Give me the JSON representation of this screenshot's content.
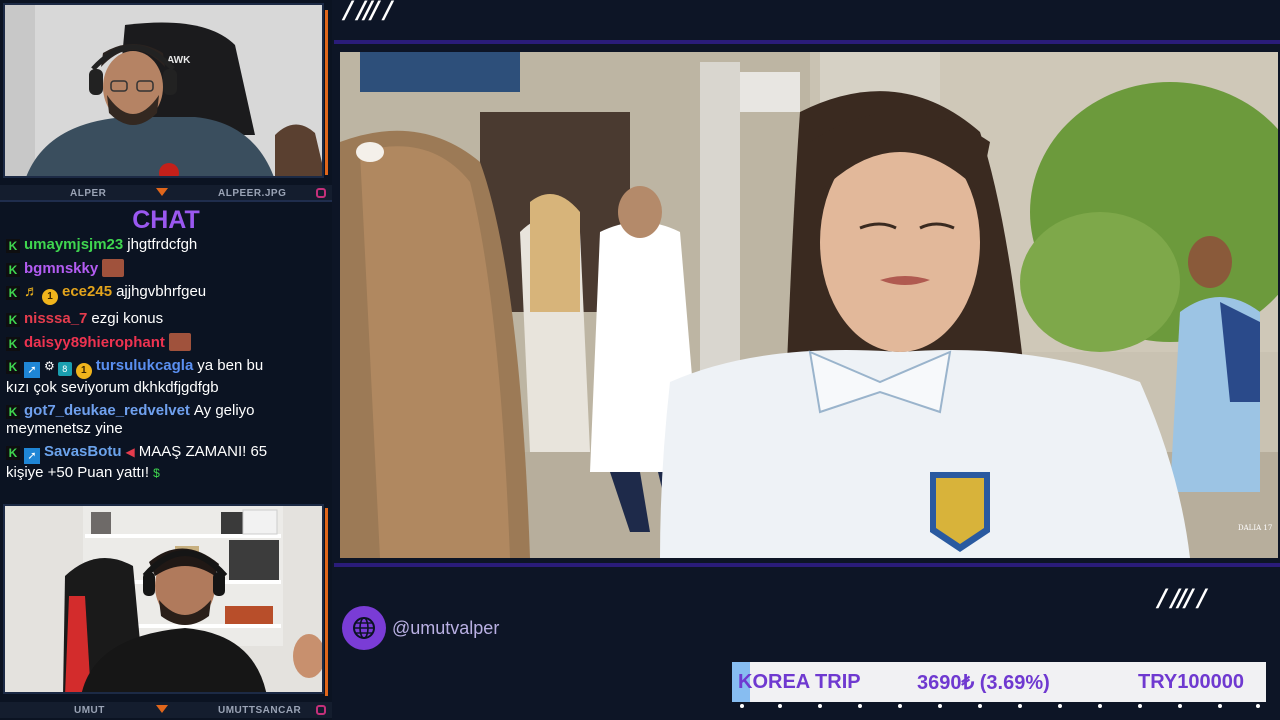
{
  "top_cam": {
    "name_left": "ALPER",
    "name_right": "ALPEER.JPG"
  },
  "bottom_cam": {
    "name_left": "UMUT",
    "name_right": "UMUTTSANCAR"
  },
  "chat": {
    "title": "CHAT",
    "messages": [
      {
        "user": "umaymjsjm23",
        "color": "#3fd64f",
        "text": "jhgtfrdcfgh",
        "text2": ""
      },
      {
        "user": "bgmnskky",
        "color": "#b35cf2",
        "text": "",
        "text2": ""
      },
      {
        "user": "ece245",
        "color": "#e3a41c",
        "text": "ajjhgvbhrfgeu",
        "text2": ""
      },
      {
        "user": "nisssa_7",
        "color": "#e53c4d",
        "text": "ezgi konus",
        "text2": ""
      },
      {
        "user": "daisyy89hierophant",
        "color": "#ee3350",
        "text": "",
        "text2": ""
      },
      {
        "user": "tursulukcagla",
        "color": "#5a8ff0",
        "text": "ya ben bu",
        "text2": "kızı çok seviyorum dkhkdfjgdfgb"
      },
      {
        "user": "got7_deukae_redvelvet",
        "color": "#6fa0ee",
        "text": "Ay geliyo",
        "text2": "meymenetsz yine"
      },
      {
        "user": "SavasBotu",
        "color": "#6ba3ec",
        "text": "MAAŞ ZAMANI! 65",
        "text2": "kişiye +50 Puan yattı!"
      }
    ]
  },
  "handle": "@umutvalper",
  "ticker": {
    "name": "KOREA TRIP",
    "amount": "3690₺ (3.69%)",
    "goal": "TRY100000"
  },
  "decor": {
    "slashes_top": "/ /// /",
    "slashes_right": "/ /// /"
  },
  "video": {
    "watermark": "DALIA 17"
  }
}
